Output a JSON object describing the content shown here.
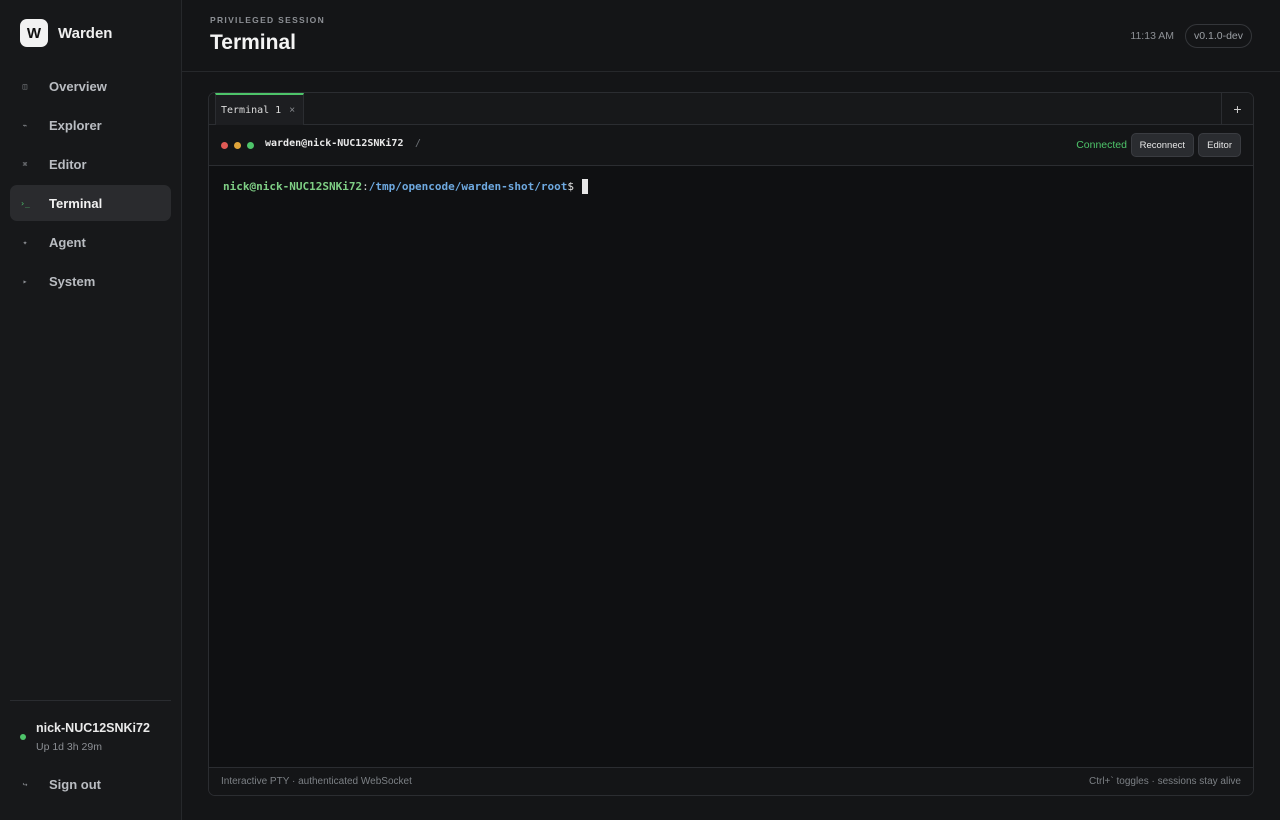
{
  "app": {
    "name": "Warden",
    "logo_letter": "W"
  },
  "sidebar": {
    "items": [
      {
        "label": "Overview",
        "icon": "◫",
        "icon_name": "overview-icon",
        "active": false
      },
      {
        "label": "Explorer",
        "icon": "⌁",
        "icon_name": "explorer-icon",
        "active": false
      },
      {
        "label": "Editor",
        "icon": "⌘",
        "icon_name": "editor-icon",
        "active": false
      },
      {
        "label": "Terminal",
        "icon": "›_",
        "icon_name": "terminal-icon",
        "active": true
      },
      {
        "label": "Agent",
        "icon": "✦",
        "icon_name": "agent-icon",
        "active": false
      },
      {
        "label": "System",
        "icon": "▸",
        "icon_name": "system-icon",
        "active": false
      }
    ],
    "host": {
      "name": "nick-NUC12SNKi72",
      "uptime": "Up 1d 3h 29m",
      "status_color": "#4ec46a"
    },
    "signout": {
      "label": "Sign out",
      "icon": "↪"
    }
  },
  "header": {
    "eyebrow": "PRIVILEGED SESSION",
    "title": "Terminal",
    "clock": "11:13 AM",
    "version": "v0.1.0-dev"
  },
  "terminal": {
    "tabs": [
      {
        "label": "Terminal 1",
        "close": "×",
        "active": true
      }
    ],
    "add_tab": "+",
    "session": {
      "user": "warden@nick-NUC12SNKi72",
      "path": "/",
      "status": "Connected",
      "reconnect_label": "Reconnect",
      "editor_label": "Editor",
      "dot_colors": [
        "#e05a55",
        "#e0a43a",
        "#4ec46a"
      ]
    },
    "prompt": {
      "user_host": "nick@nick-NUC12SNKi72",
      "colon": ":",
      "path": "/tmp/opencode/warden-shot/root",
      "symbol": "$"
    },
    "footer_left": "Interactive PTY · authenticated WebSocket",
    "footer_right": "Ctrl+` toggles · sessions stay alive"
  },
  "colors": {
    "accent": "#4ec46a",
    "background": "#141517",
    "path_blue": "#6ea9e0"
  }
}
